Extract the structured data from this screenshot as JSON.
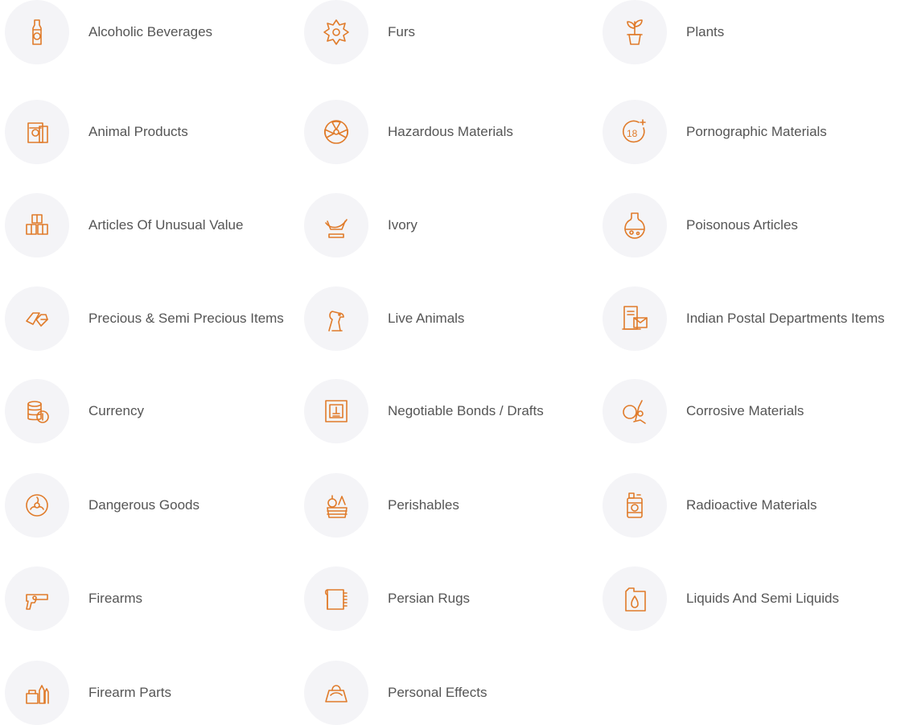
{
  "theme": {
    "icon_color": "#e07b2a",
    "circle_bg": "#f4f4f7",
    "text_color": "#555555"
  },
  "columns": [
    {
      "items": [
        {
          "label": "Alcoholic Beverages",
          "icon": "bottle-icon"
        },
        {
          "label": "Animal Products",
          "icon": "animal-product-icon"
        },
        {
          "label": "Articles Of Unusual Value",
          "icon": "cargo-boxes-icon"
        },
        {
          "label": "Precious & Semi Precious Items",
          "icon": "gem-icon"
        },
        {
          "label": "Currency",
          "icon": "coins-icon"
        },
        {
          "label": "Dangerous Goods",
          "icon": "biohazard-icon"
        },
        {
          "label": "Firearms",
          "icon": "revolver-icon"
        },
        {
          "label": "Firearm Parts",
          "icon": "ammo-icon"
        }
      ]
    },
    {
      "items": [
        {
          "label": "Furs",
          "icon": "fur-pelt-icon"
        },
        {
          "label": "Hazardous Materials",
          "icon": "radiation-icon"
        },
        {
          "label": "Ivory",
          "icon": "tusk-icon"
        },
        {
          "label": "Live Animals",
          "icon": "dog-icon"
        },
        {
          "label": "Negotiable Bonds / Drafts",
          "icon": "bond-certificate-icon"
        },
        {
          "label": "Perishables",
          "icon": "fruit-basket-icon"
        },
        {
          "label": "Persian Rugs",
          "icon": "rug-icon"
        },
        {
          "label": "Personal Effects",
          "icon": "purse-icon"
        }
      ]
    },
    {
      "items": [
        {
          "label": "Plants",
          "icon": "potted-plant-icon"
        },
        {
          "label": "Pornographic Materials",
          "icon": "age-18-plus-icon"
        },
        {
          "label": "Poisonous Articles",
          "icon": "poison-flask-icon"
        },
        {
          "label": "Indian Postal Departments Items",
          "icon": "postbox-letter-icon"
        },
        {
          "label": "Corrosive Materials",
          "icon": "corrosive-flask-icon"
        },
        {
          "label": "Radioactive Materials",
          "icon": "radioactive-barrel-icon"
        },
        {
          "label": "Liquids And Semi Liquids",
          "icon": "liquid-container-icon"
        }
      ]
    }
  ]
}
